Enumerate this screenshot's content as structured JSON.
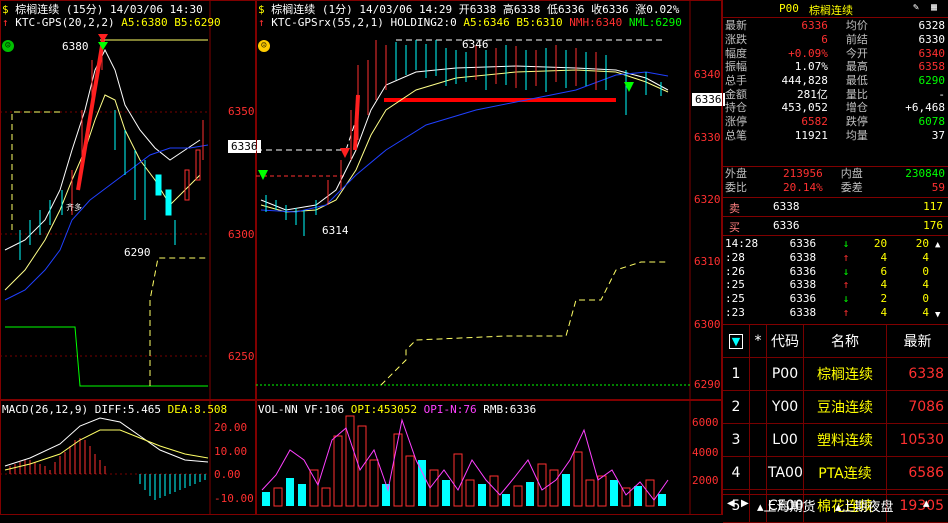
{
  "left_chart": {
    "title": "棕榈连续",
    "period": "(15分)",
    "time": "14/03/06 14:30",
    "indicator": "KTC-GPS(20,2,2)",
    "a5": "A5:6380",
    "b5": "B5:6290",
    "hi_label": "6380",
    "lo_label": "6290",
    "marker_a": "齐多",
    "price_tag": "6336",
    "axis": [
      "6350",
      "6300",
      "6250"
    ]
  },
  "mid_chart": {
    "title": "棕榈连续",
    "period": "(1分)",
    "time": "14/03/06 14:29",
    "open": "开6338",
    "high": "高6338",
    "low": "低6336",
    "close": "收6336",
    "change": "涨0.02%",
    "indicator": "KTC-GPSrx(55,2,1)",
    "holding": "HOLDING2:0",
    "a5": "A5:6346",
    "b5": "B5:6310",
    "nmh": "NMH:6340",
    "nml": "NML:6290",
    "hi_label": "6346",
    "lo_label": "6314",
    "price_tag": "6336",
    "axis": [
      "6340",
      "6330",
      "6320",
      "6310",
      "6300",
      "6290"
    ]
  },
  "macd": {
    "label": "MACD(26,12,9)",
    "diff": "DIFF:5.465",
    "dea": "DEA:8.508",
    "axis": [
      "20.00",
      "10.00",
      "0.00",
      "-10.00"
    ]
  },
  "vol": {
    "label": "VOL-NN",
    "vf": "VF:106",
    "opi": "OPI:453052",
    "opin": "OPI-N:76",
    "rmb": "RMB:6336",
    "axis": [
      "6000",
      "4000",
      "2000"
    ]
  },
  "quote": {
    "code": "P00",
    "name": "棕榈连续",
    "rows": [
      {
        "l1": "最新",
        "v1": "6336",
        "l2": "均价",
        "v2": "6328",
        "c1": "r",
        "c2": "w"
      },
      {
        "l1": "涨跌",
        "v1": "6",
        "l2": "前结",
        "v2": "6330",
        "c1": "r",
        "c2": "w"
      },
      {
        "l1": "幅度",
        "v1": "+0.09%",
        "l2": "今开",
        "v2": "6340",
        "c1": "r",
        "c2": "r"
      },
      {
        "l1": "振幅",
        "v1": "1.07%",
        "l2": "最高",
        "v2": "6358",
        "c1": "w",
        "c2": "r"
      },
      {
        "l1": "总手",
        "v1": "444,828",
        "l2": "最低",
        "v2": "6290",
        "c1": "w",
        "c2": "g"
      },
      {
        "l1": "金额",
        "v1": "281亿",
        "l2": "量比",
        "v2": "-",
        "c1": "w",
        "c2": "w"
      },
      {
        "l1": "持仓",
        "v1": "453,052",
        "l2": "增仓",
        "v2": "+6,468",
        "c1": "w",
        "c2": "w"
      },
      {
        "l1": "涨停",
        "v1": "6582",
        "l2": "跌停",
        "v2": "6078",
        "c1": "r",
        "c2": "g"
      },
      {
        "l1": "总笔",
        "v1": "11921",
        "l2": "均量",
        "v2": "37",
        "c1": "w",
        "c2": "w"
      }
    ],
    "outer": {
      "l1": "外盘",
      "v1": "213956",
      "l2": "内盘",
      "v2": "230840"
    },
    "ratio": {
      "l1": "委比",
      "v1": "20.14%",
      "l2": "委差",
      "v2": "59"
    },
    "sell": {
      "label": "卖",
      "price": "6338",
      "vol": "117"
    },
    "buy": {
      "label": "买",
      "price": "6336",
      "vol": "176"
    }
  },
  "ticks": [
    {
      "t": "14:28",
      "p": "6336",
      "d": "↓",
      "v": "20",
      "o": "20",
      "dc": "g"
    },
    {
      "t": ":28",
      "p": "6338",
      "d": "↑",
      "v": "4",
      "o": "4",
      "dc": "r"
    },
    {
      "t": ":26",
      "p": "6336",
      "d": "↓",
      "v": "6",
      "o": "0",
      "dc": "g"
    },
    {
      "t": ":25",
      "p": "6338",
      "d": "↑",
      "v": "4",
      "o": "4",
      "dc": "r"
    },
    {
      "t": ":25",
      "p": "6336",
      "d": "↓",
      "v": "2",
      "o": "0",
      "dc": "g"
    },
    {
      "t": ":23",
      "p": "6338",
      "d": "↑",
      "v": "4",
      "o": "4",
      "dc": "r"
    }
  ],
  "list": {
    "headers": [
      "▼",
      "*",
      "代码",
      "名称",
      "最新"
    ],
    "rows": [
      {
        "n": "1",
        "code": "P00",
        "name": "棕榈连续",
        "price": "6338"
      },
      {
        "n": "2",
        "code": "Y00",
        "name": "豆油连续",
        "price": "7086"
      },
      {
        "n": "3",
        "code": "L00",
        "name": "塑料连续",
        "price": "10530"
      },
      {
        "n": "4",
        "code": "TA00",
        "name": "PTA连续",
        "price": "6586"
      },
      {
        "n": "5",
        "code": "CF00",
        "name": "棉花连续",
        "price": "19305"
      }
    ],
    "tabs": [
      "上海期货",
      "上期夜盘"
    ]
  },
  "colors": {
    "up": "#ff3030",
    "down": "#00ffff",
    "frame": "#800000"
  }
}
